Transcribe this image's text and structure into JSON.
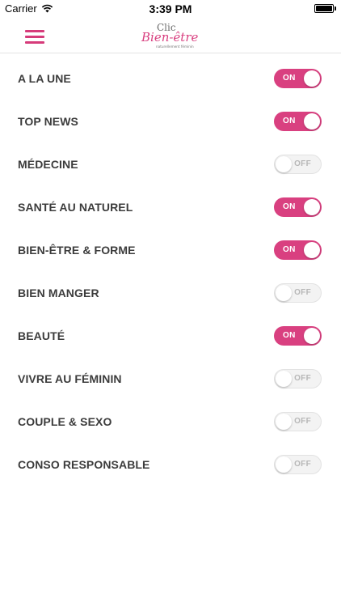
{
  "status_bar": {
    "carrier": "Carrier",
    "time": "3:39 PM",
    "icons": [
      "wifi-icon",
      "battery-icon"
    ]
  },
  "nav": {
    "menu_icon": "hamburger-menu-icon",
    "logo": {
      "line1": "Clic",
      "line2": "Bien-être",
      "tagline": "naturellement féminin"
    }
  },
  "colors": {
    "accent": "#d94080",
    "off_track": "#f3f3f3",
    "off_text": "#b7b7b7",
    "label": "#3c3c3c"
  },
  "toggles": [
    {
      "label": "A LA UNE",
      "state": "ON"
    },
    {
      "label": "TOP NEWS",
      "state": "ON"
    },
    {
      "label": "MÉDECINE",
      "state": "OFF"
    },
    {
      "label": "SANTÉ AU NATUREL",
      "state": "ON"
    },
    {
      "label": "BIEN-ÊTRE & FORME",
      "state": "ON"
    },
    {
      "label": "BIEN MANGER",
      "state": "OFF"
    },
    {
      "label": "BEAUTÉ",
      "state": "ON"
    },
    {
      "label": "VIVRE AU FÉMININ",
      "state": "OFF"
    },
    {
      "label": "COUPLE & SEXO",
      "state": "OFF"
    },
    {
      "label": "CONSO RESPONSABLE",
      "state": "OFF"
    }
  ]
}
